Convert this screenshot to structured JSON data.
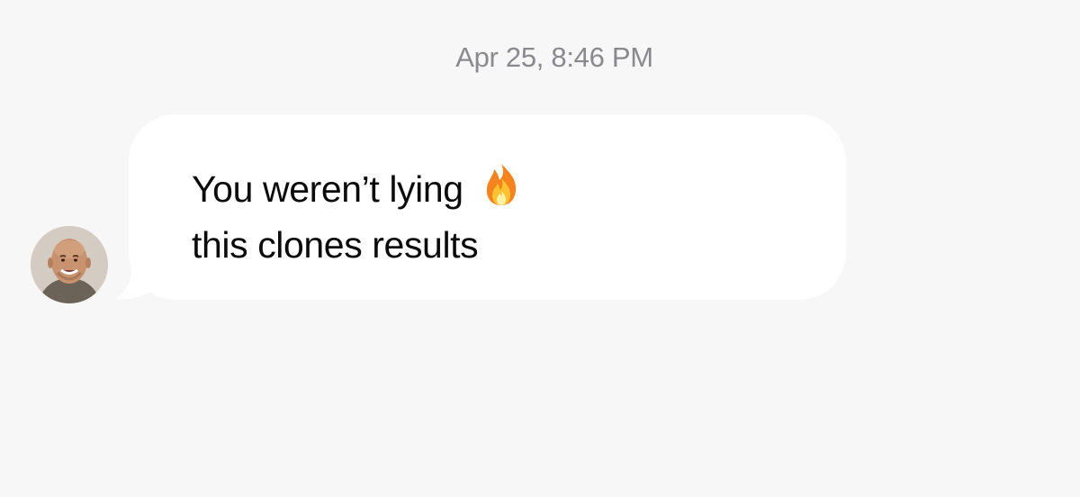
{
  "conversation": {
    "timestamp": "Apr 25, 8:46 PM",
    "messages": [
      {
        "direction": "incoming",
        "sender_avatar": "avatar",
        "lines": [
          "You weren’t lying",
          "this clones results"
        ],
        "emoji": "fire-icon"
      }
    ]
  },
  "colors": {
    "background": "#f7f7f7",
    "bubble": "#ffffff",
    "timestamp_text": "#8a8a8e",
    "message_text": "#0b0b0b"
  }
}
